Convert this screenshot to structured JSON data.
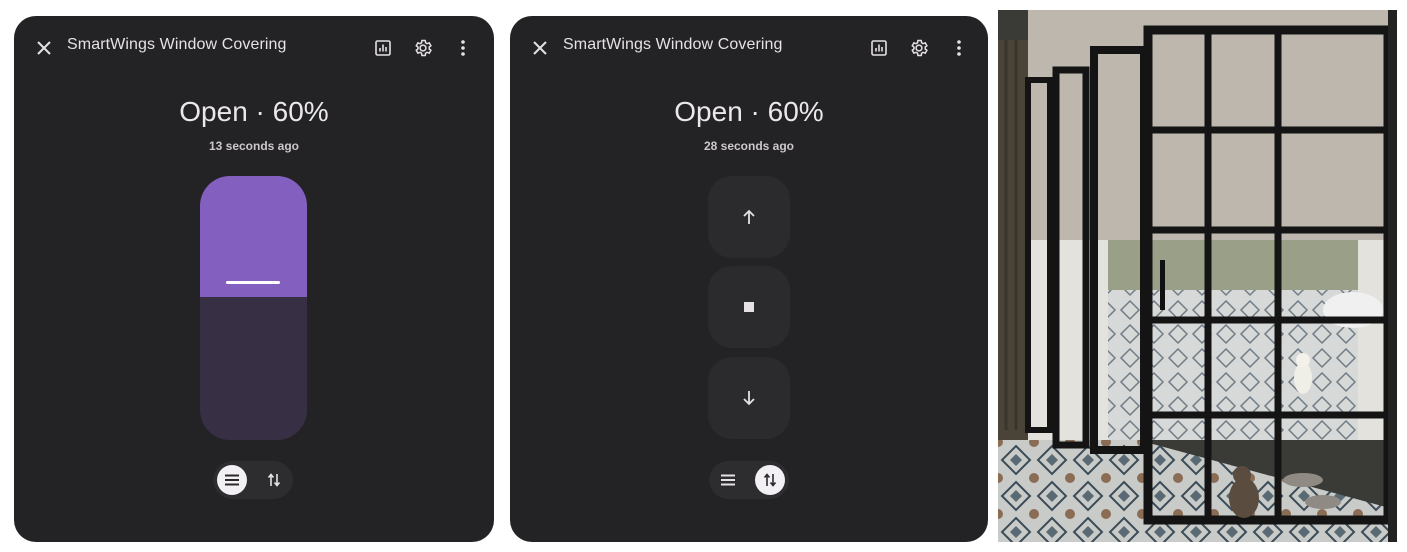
{
  "dialogs": [
    {
      "title": "SmartWings Window Covering",
      "state": "Open · 60%",
      "last_changed": "13 seconds ago",
      "position": 60,
      "mode": "position",
      "accent": "#8360c0"
    },
    {
      "title": "SmartWings Window Covering",
      "state": "Open · 60%",
      "last_changed": "28 seconds ago",
      "mode": "buttons",
      "buttons": [
        "open-cover",
        "stop-cover",
        "close-cover"
      ]
    }
  ],
  "photo": {
    "subject": "black-framed glass doors with window shade, two cats on tiled floor"
  },
  "colors": {
    "dialog_bg": "#232224",
    "slider_track": "#373044",
    "slider_fill": "#8360c0",
    "button_bg": "#2b2a2c"
  },
  "icons": [
    "close-icon",
    "history-icon",
    "settings-gear-icon",
    "more-vertical-icon",
    "list-icon",
    "swap-vertical-icon",
    "arrow-up-icon",
    "stop-icon",
    "arrow-down-icon"
  ]
}
